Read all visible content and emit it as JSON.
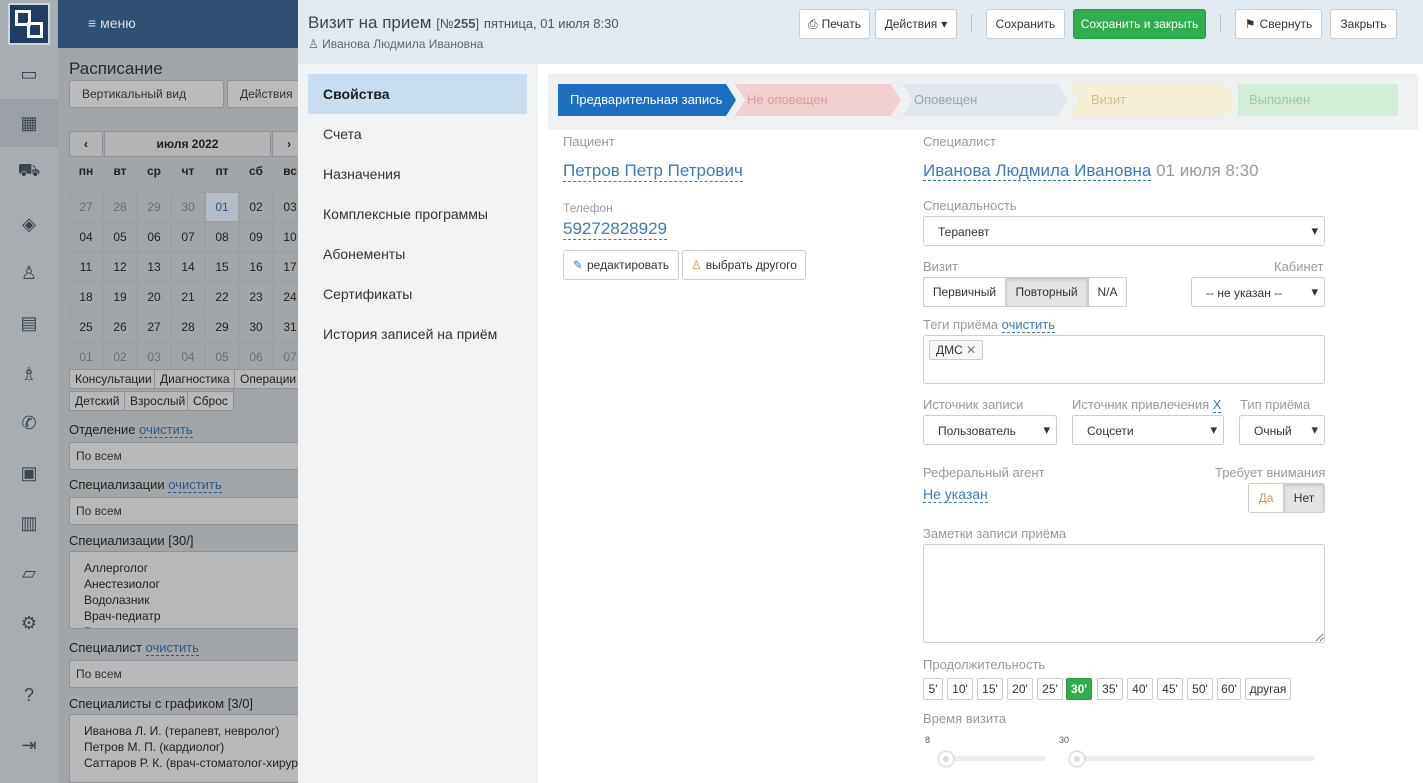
{
  "rail": {
    "icons": [
      "logo-qr-icon",
      "monitor-icon",
      "calendar-icon",
      "ambulance-icon",
      "ticket-icon",
      "user-icon",
      "book-icon",
      "chess-icon",
      "phone-icon",
      "briefcase-icon",
      "bar-chart-icon",
      "folder-icon",
      "gear-icon",
      "help-icon",
      "logout-icon"
    ]
  },
  "bg": {
    "menu_label": "меню",
    "title": "Расписание",
    "view_select": "Вертикальный вид",
    "actions_select": "Действия",
    "month_label": "июля 2022",
    "weekdays": [
      "пн",
      "вт",
      "ср",
      "чт",
      "пт",
      "сб",
      "вс"
    ],
    "days": [
      "27",
      "28",
      "29",
      "30",
      "01",
      "02",
      "03",
      "04",
      "05",
      "06",
      "07",
      "08",
      "09",
      "10",
      "11",
      "12",
      "13",
      "14",
      "15",
      "16",
      "17",
      "18",
      "19",
      "20",
      "21",
      "22",
      "23",
      "24",
      "25",
      "26",
      "27",
      "28",
      "29",
      "30",
      "31",
      "01",
      "02",
      "03",
      "04",
      "05",
      "06",
      "07"
    ],
    "chips_row1": [
      "Консультации",
      "Диагностика",
      "Операции"
    ],
    "chips_row2": [
      "Детский",
      "Взрослый",
      "Сброс"
    ],
    "dept_label": "Отделение",
    "clear": "очистить",
    "all": "По всем",
    "spec_label": "Специализации",
    "spec_list_label": "Специализации [30/]",
    "spec_list": [
      "Аллерголог",
      "Анестезиолог",
      "Водолазник",
      "Врач-педиатр",
      "Врач-стоматолог-хирург"
    ],
    "doctor_label": "Специалист",
    "doctors_label": "Специалисты с графиком [3/0]",
    "doctors": [
      "Иванова Л. И. (терапевт, невролог)",
      "Петров М. П. (кардиолог)",
      "Саттаров Р. К. (врач-стоматолог-хирург)"
    ]
  },
  "modal": {
    "title": "Визит на прием",
    "number_prefix": "[№",
    "number": "255",
    "number_suffix": "]",
    "date": "пятница, 01 июля 8:30",
    "subtitle": "Иванова Людмила Ивановна",
    "buttons": {
      "print": "Печать",
      "actions": "Действия",
      "save": "Сохранить",
      "save_close": "Сохранить и закрыть",
      "collapse": "Свернуть",
      "close": "Закрыть"
    },
    "nav": [
      "Свойства",
      "Счета",
      "Назначения",
      "Комплексные программы",
      "Абонементы",
      "Сертификаты",
      "История записей на приём"
    ],
    "steps": [
      "Предварительная запись",
      "Не оповещен",
      "Оповещен",
      "Визит",
      "Выполнен"
    ],
    "colors": {
      "step_active": "#1c6fc0",
      "step2": "#f1d0d2",
      "step3": "#dfe6ee",
      "step4": "#f5efd6",
      "step5": "#d3ecd8",
      "green": "#2fae4e",
      "link": "#3a7bbd"
    },
    "patient": {
      "label": "Пациент",
      "name": "Петров Петр Петрович",
      "phone_label": "Телефон",
      "phone": "59272828929",
      "edit": "редактировать",
      "choose": "выбрать другого"
    },
    "specialist": {
      "label": "Специалист",
      "name": "Иванова Людмила Ивановна",
      "time": "01 июля 8:30"
    },
    "specialty": {
      "label": "Специальность",
      "value": "Терапевт"
    },
    "visit": {
      "label": "Визит",
      "options": [
        "Первичный",
        "Повторный",
        "N/A"
      ],
      "selected": "Повторный"
    },
    "cabinet": {
      "label": "Кабинет",
      "value": "-- не указан --"
    },
    "tags": {
      "label": "Теги приёма",
      "clear": "очистить",
      "items": [
        "ДМС"
      ]
    },
    "source": {
      "label": "Источник записи",
      "value": "Пользователь"
    },
    "attract": {
      "label": "Источник привлечения",
      "clear": "X",
      "value": "Соцсети"
    },
    "type": {
      "label": "Тип приёма",
      "value": "Очный"
    },
    "referral": {
      "label": "Реферальный агент",
      "value": "Не указан"
    },
    "attention": {
      "label": "Требует внимания",
      "yes": "Да",
      "no": "Нет",
      "selected": "Нет"
    },
    "notes": {
      "label": "Заметки записи приёма",
      "value": ""
    },
    "duration": {
      "label": "Продолжительность",
      "options": [
        "5'",
        "10'",
        "15'",
        "20'",
        "25'",
        "30'",
        "35'",
        "40'",
        "45'",
        "50'",
        "60'",
        "другая"
      ],
      "selected": "30'"
    },
    "visit_time": {
      "label": "Время визита",
      "hour": "8",
      "minute": "30"
    }
  }
}
